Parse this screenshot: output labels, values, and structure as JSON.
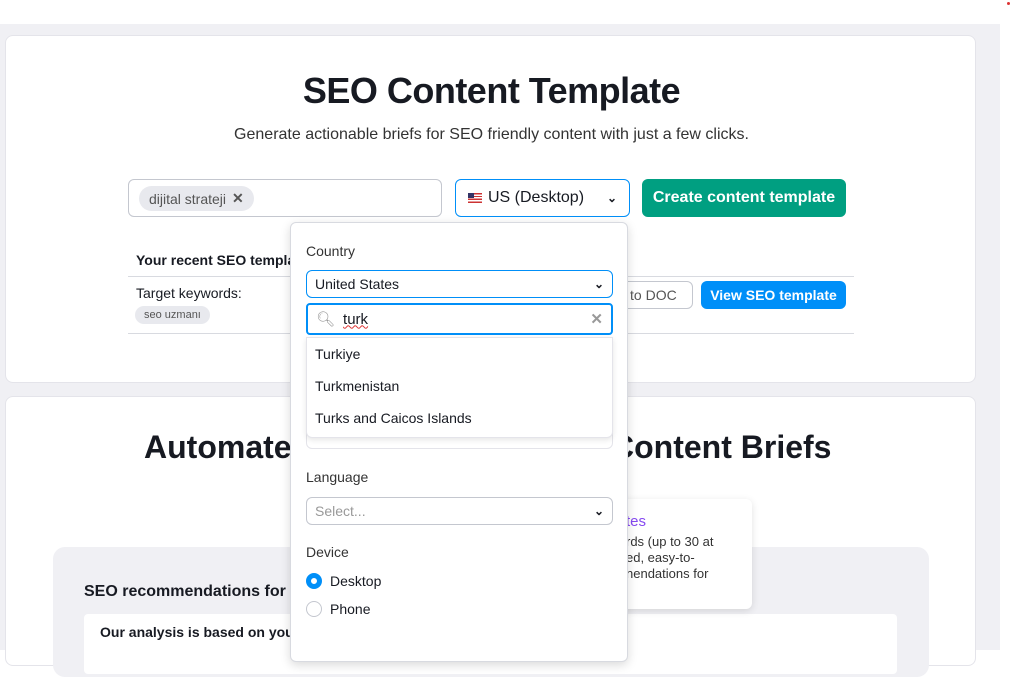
{
  "hero": {
    "title": "SEO Content Template",
    "subtitle": "Generate actionable briefs for SEO friendly content with just a few clicks."
  },
  "keyword_input": {
    "chips": [
      "dijital strateji"
    ]
  },
  "location_select": {
    "value": "US (Desktop)"
  },
  "create_button": "Create content template",
  "recent": {
    "heading": "Your recent SEO templa",
    "target_label": "Target keywords:",
    "keyword_chip": "seo uzmanı",
    "export_button": "t to DOC",
    "view_button": "View SEO template"
  },
  "section2": {
    "title_left": "Automate",
    "title_right": "Content Briefs",
    "promo_title": "tes",
    "promo_text": [
      "rds (up to 30 at",
      "ed, easy-to-",
      "nendations for"
    ],
    "rec_heading": "SEO recommendations for",
    "analysis": "Our analysis is based on you"
  },
  "dropdown": {
    "country_label": "Country",
    "country_value": "United States",
    "search_value": "turk",
    "options": [
      "Turkiye",
      "Turkmenistan",
      "Turks and Caicos Islands"
    ],
    "language_label": "Language",
    "language_placeholder": "Select...",
    "device_label": "Device",
    "devices": [
      {
        "label": "Desktop",
        "selected": true
      },
      {
        "label": "Phone",
        "selected": false
      }
    ]
  },
  "colors": {
    "primary_green": "#009f81",
    "blue": "#008ff8",
    "purple": "#8649f1"
  }
}
